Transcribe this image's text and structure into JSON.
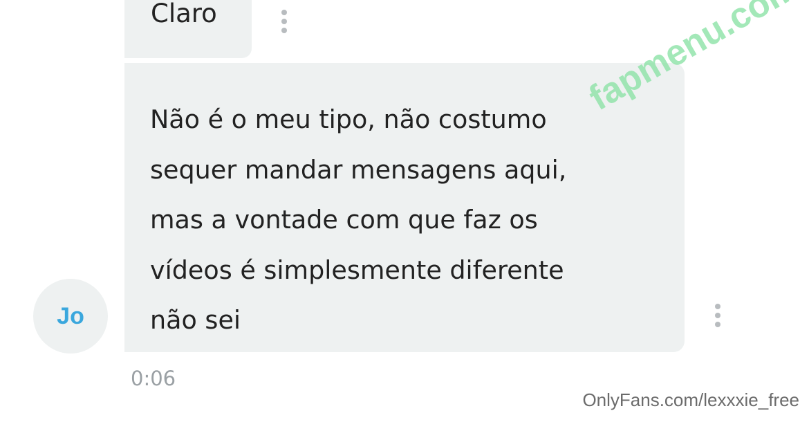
{
  "messages": [
    {
      "text": "Claro"
    },
    {
      "lines": "Não é o meu tipo, não costumo\nsequer mandar mensagens aqui,\nmas a vontade com que faz os\nvídeos é simplesmente diferente\nnão sei"
    }
  ],
  "sender": {
    "initials": "Jo"
  },
  "timestamp": "0:06",
  "watermarks": {
    "site": "fapmenu.com",
    "footer": "OnlyFans.com/lexxxie_free"
  },
  "icons": {
    "message_menu": "more-vertical-icon"
  },
  "colors": {
    "bubble": "#eef1f1",
    "avatar_text": "#3aa7dd",
    "menu_dots": "#b8bcbf",
    "timestamp": "#9aa0a4",
    "watermark": "#8fe3a9"
  }
}
